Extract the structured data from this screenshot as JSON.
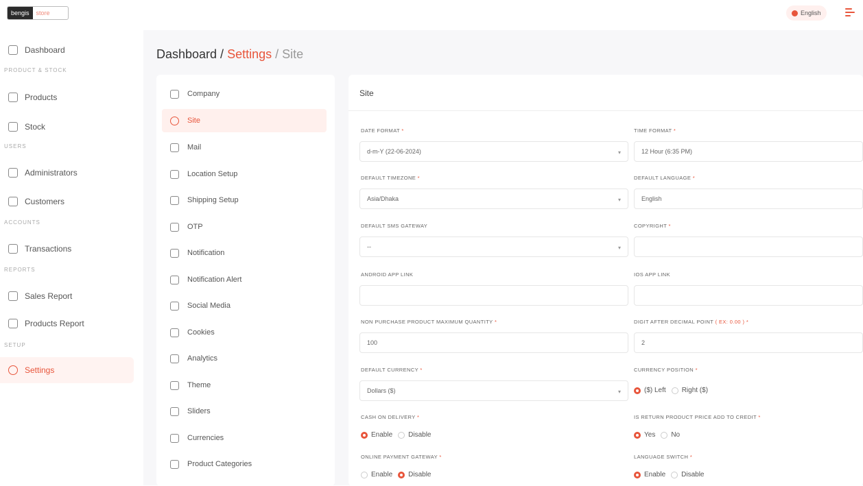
{
  "app": {
    "logo_left": "bengis",
    "logo_right": "store",
    "language": "English"
  },
  "sidebar": {
    "dashboard": "Dashboard",
    "head_product": "PRODUCT & STOCK",
    "products": "Products",
    "stock": "Stock",
    "head_users": "USERS",
    "administrators": "Administrators",
    "customers": "Customers",
    "head_accounts": "ACCOUNTS",
    "transactions": "Transactions",
    "head_reports": "REPORTS",
    "sales_report": "Sales Report",
    "products_report": "Products Report",
    "head_setup": "SETUP",
    "settings": "Settings"
  },
  "breadcrumb": {
    "part1": "Dashboard / ",
    "part2": "Settings",
    "part3": " / Site"
  },
  "settings_nav": [
    {
      "label": "Company"
    },
    {
      "label": "Site"
    },
    {
      "label": "Mail"
    },
    {
      "label": "Location Setup"
    },
    {
      "label": "Shipping Setup"
    },
    {
      "label": "OTP"
    },
    {
      "label": "Notification"
    },
    {
      "label": "Notification Alert"
    },
    {
      "label": "Social Media"
    },
    {
      "label": "Cookies"
    },
    {
      "label": "Analytics"
    },
    {
      "label": "Theme"
    },
    {
      "label": "Sliders"
    },
    {
      "label": "Currencies"
    },
    {
      "label": "Product Categories"
    }
  ],
  "panel": {
    "title": "Site",
    "date_format_label": "DATE FORMAT",
    "date_format_value": "d-m-Y (22-06-2024)",
    "time_format_label": "TIME FORMAT",
    "time_format_value": "12 Hour (6:35 PM)",
    "timezone_label": "DEFAULT TIMEZONE",
    "timezone_value": "Asia/Dhaka",
    "language_label": "DEFAULT LANGUAGE",
    "language_value": "English",
    "sms_label": "DEFAULT SMS GATEWAY",
    "sms_value": "--",
    "copyright_label": "COPYRIGHT",
    "android_label": "ANDROID APP LINK",
    "ios_label": "IOS APP LINK",
    "max_qty_label": "NON PURCHASE PRODUCT MAXIMUM QUANTITY",
    "max_qty_value": "100",
    "decimal_label": "DIGIT AFTER DECIMAL POINT",
    "decimal_note": "( EX: 0.00 )",
    "decimal_value": "2",
    "currency_label": "DEFAULT CURRENCY",
    "currency_value": "Dollars ($)",
    "currency_pos_label": "CURRENCY POSITION",
    "currency_pos_left": "($) Left",
    "currency_pos_right": "Right ($)",
    "cod_label": "CASH ON DELIVERY",
    "enable": "Enable",
    "disable": "Disable",
    "return_label": "IS RETURN PRODUCT PRICE ADD TO CREDIT",
    "yes": "Yes",
    "no": "No",
    "online_label": "ONLINE PAYMENT GATEWAY",
    "lang_switch_label": "LANGUAGE SWITCH",
    "required_mark": "*",
    "dropdown_caret": "▾"
  },
  "colors": {
    "accent": "#e8553b",
    "active_bg": "#fff3f1"
  }
}
